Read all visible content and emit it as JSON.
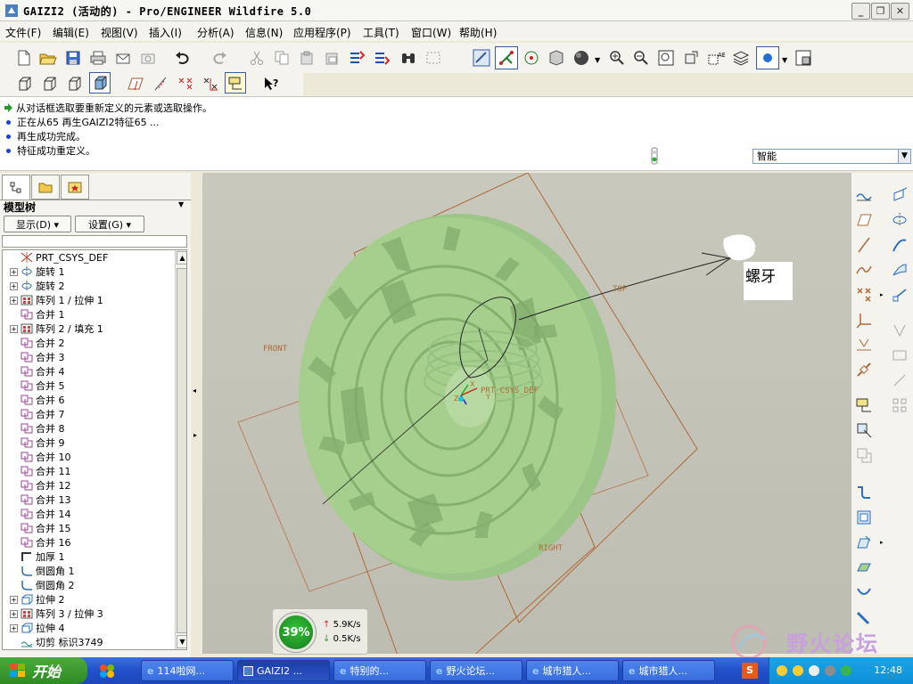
{
  "window": {
    "title": "GAIZI2 (活动的) - Pro/ENGINEER Wildfire 5.0",
    "minimize_label": "_",
    "maximize_label": "❐",
    "close_label": "✕"
  },
  "menubar": {
    "items": [
      {
        "label": "文件(F)"
      },
      {
        "label": "编辑(E)"
      },
      {
        "label": "视图(V)"
      },
      {
        "label": "插入(I)"
      },
      {
        "label": "分析(A)"
      },
      {
        "label": "信息(N)"
      },
      {
        "label": "应用程序(P)"
      },
      {
        "label": "工具(T)"
      },
      {
        "label": "窗口(W)"
      },
      {
        "label": "帮助(H)"
      }
    ]
  },
  "messages": [
    {
      "text": "从对话框选取要重新定义的元素或选取操作。",
      "kind": "prompt"
    },
    {
      "text": "正在从65 再生GAIZI2特征65 ...",
      "kind": "info"
    },
    {
      "text": "再生成功完成。",
      "kind": "info"
    },
    {
      "text": "特征成功重定义。",
      "kind": "info"
    }
  ],
  "filter_select": {
    "value": "智能"
  },
  "model_tree": {
    "title": "模型树",
    "show_button": "显示(D) ▾",
    "settings_button": "设置(G) ▾",
    "items": [
      {
        "label": "PRT_CSYS_DEF",
        "expandable": false,
        "icon": "csys-icon"
      },
      {
        "label": "旋转 1",
        "expandable": true,
        "icon": "revolve-icon"
      },
      {
        "label": "旋转 2",
        "expandable": true,
        "icon": "revolve-icon"
      },
      {
        "label": "阵列 1 / 拉伸 1",
        "expandable": true,
        "icon": "pattern-icon"
      },
      {
        "label": "合并 1",
        "expandable": false,
        "icon": "merge-icon"
      },
      {
        "label": "阵列 2 / 填充 1",
        "expandable": true,
        "icon": "pattern-icon"
      },
      {
        "label": "合并 2",
        "expandable": false,
        "icon": "merge-icon"
      },
      {
        "label": "合并 3",
        "expandable": false,
        "icon": "merge-icon"
      },
      {
        "label": "合并 4",
        "expandable": false,
        "icon": "merge-icon"
      },
      {
        "label": "合并 5",
        "expandable": false,
        "icon": "merge-icon"
      },
      {
        "label": "合并 6",
        "expandable": false,
        "icon": "merge-icon"
      },
      {
        "label": "合并 7",
        "expandable": false,
        "icon": "merge-icon"
      },
      {
        "label": "合并 8",
        "expandable": false,
        "icon": "merge-icon"
      },
      {
        "label": "合并 9",
        "expandable": false,
        "icon": "merge-icon"
      },
      {
        "label": "合并 10",
        "expandable": false,
        "icon": "merge-icon"
      },
      {
        "label": "合并 11",
        "expandable": false,
        "icon": "merge-icon"
      },
      {
        "label": "合并 12",
        "expandable": false,
        "icon": "merge-icon"
      },
      {
        "label": "合并 13",
        "expandable": false,
        "icon": "merge-icon"
      },
      {
        "label": "合并 14",
        "expandable": false,
        "icon": "merge-icon"
      },
      {
        "label": "合并 15",
        "expandable": false,
        "icon": "merge-icon"
      },
      {
        "label": "合并 16",
        "expandable": false,
        "icon": "merge-icon"
      },
      {
        "label": "加厚 1",
        "expandable": false,
        "icon": "thicken-icon"
      },
      {
        "label": "倒圆角 1",
        "expandable": false,
        "icon": "round-icon"
      },
      {
        "label": "倒圆角 2",
        "expandable": false,
        "icon": "round-icon"
      },
      {
        "label": "拉伸 2",
        "expandable": true,
        "icon": "extrude-icon"
      },
      {
        "label": "阵列 3 / 拉伸 3",
        "expandable": true,
        "icon": "pattern-icon"
      },
      {
        "label": "拉伸 4",
        "expandable": true,
        "icon": "extrude-icon"
      },
      {
        "label": "切剪 标识3749",
        "expandable": false,
        "icon": "cut-icon"
      }
    ]
  },
  "viewport": {
    "datum_labels": {
      "front": "FRONT",
      "top": "TOP",
      "right": "RIGHT",
      "csys": "PRT_CSYS_DEF",
      "x": "X",
      "y": "Y",
      "z": "Z"
    },
    "annotation": "螺牙",
    "model_color": "#a6cf8e"
  },
  "network_widget": {
    "percent": "39%",
    "upload": "5.9K/s",
    "download": "0.5K/s"
  },
  "watermark": {
    "text": "野火论坛"
  },
  "taskbar": {
    "start_label": "开始",
    "tasks": [
      {
        "label": "114啦网..."
      },
      {
        "label": "GAIZI2 ..."
      },
      {
        "label": "特别的..."
      },
      {
        "label": "野火论坛..."
      },
      {
        "label": "城市猎人..."
      },
      {
        "label": "城市猎人..."
      }
    ],
    "clock": "12:48"
  }
}
